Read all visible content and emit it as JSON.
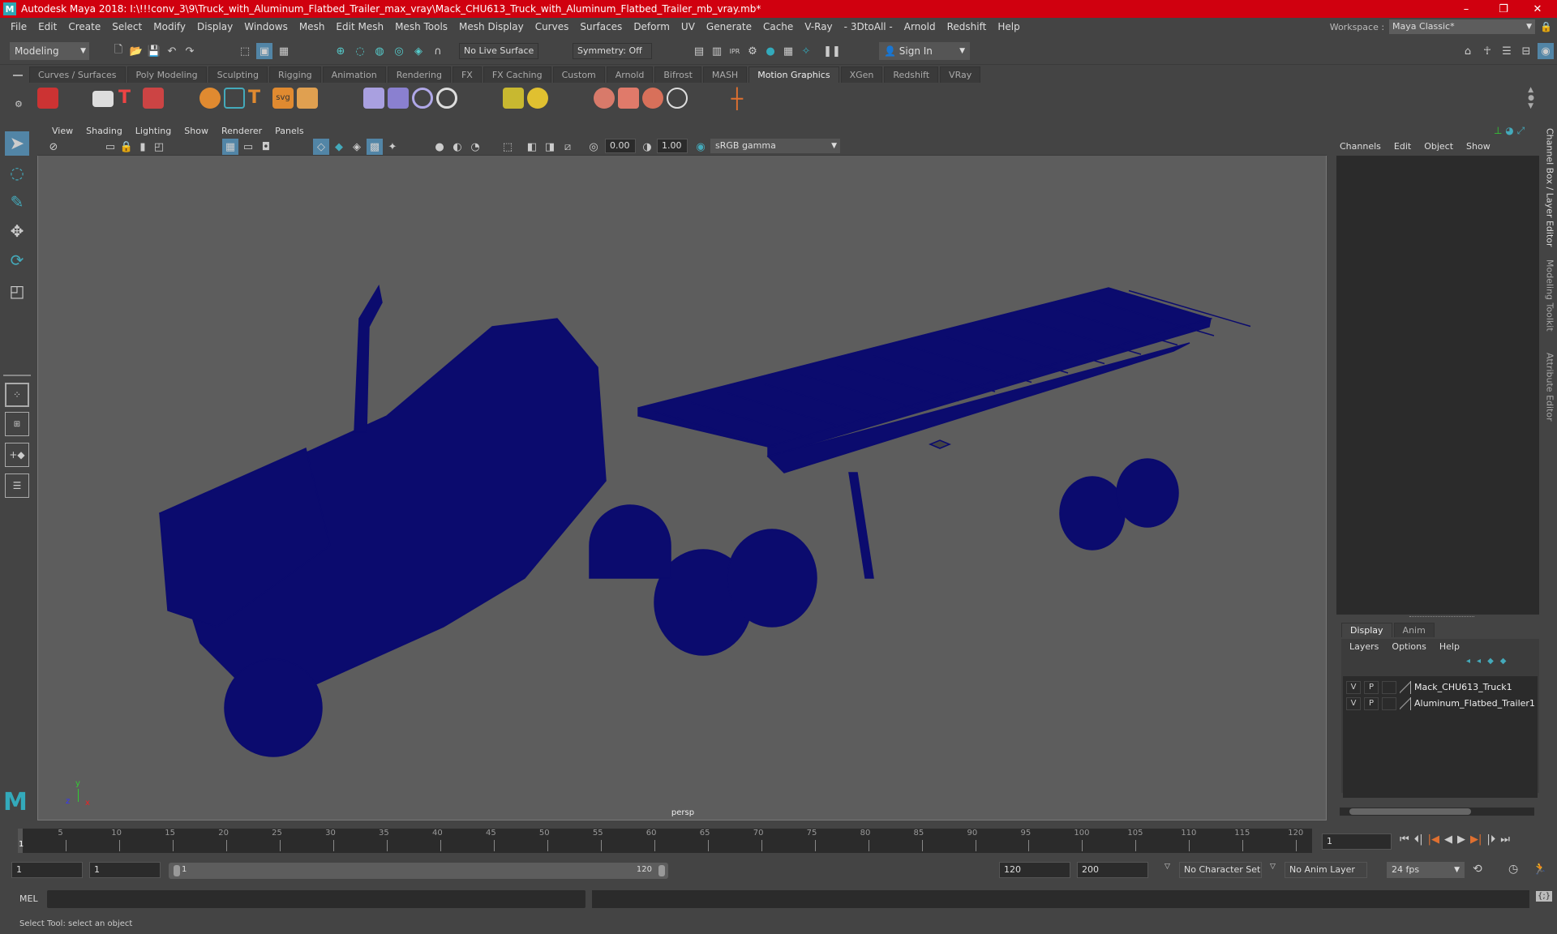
{
  "window": {
    "title": "Autodesk Maya 2018: I:\\!!!conv_3\\9\\Truck_with_Aluminum_Flatbed_Trailer_max_vray\\Mack_CHU613_Truck_with_Aluminum_Flatbed_Trailer_mb_vray.mb*",
    "logo": "M",
    "minimize": "–",
    "restore": "❐",
    "close": "✕"
  },
  "menubar": {
    "items": [
      "File",
      "Edit",
      "Create",
      "Select",
      "Modify",
      "Display",
      "Windows",
      "Mesh",
      "Edit Mesh",
      "Mesh Tools",
      "Mesh Display",
      "Curves",
      "Surfaces",
      "Deform",
      "UV",
      "Generate",
      "Cache",
      "V-Ray",
      "- 3DtoAll -",
      "Arnold",
      "Redshift",
      "Help"
    ],
    "workspace_label": "Workspace :",
    "workspace_value": "Maya Classic*"
  },
  "statusline": {
    "mode": "Modeling",
    "live_surface": "No Live Surface",
    "symmetry": "Symmetry: Off",
    "sign_in": "Sign In"
  },
  "shelf": {
    "tabs": [
      "Curves / Surfaces",
      "Poly Modeling",
      "Sculpting",
      "Rigging",
      "Animation",
      "Rendering",
      "FX",
      "FX Caching",
      "Custom",
      "Arnold",
      "Bifrost",
      "MASH",
      "Motion Graphics",
      "XGen",
      "Redshift",
      "VRay"
    ],
    "active_tab": "Motion Graphics"
  },
  "viewport": {
    "menu": [
      "View",
      "Shading",
      "Lighting",
      "Show",
      "Renderer",
      "Panels"
    ],
    "exposure": "0.00",
    "gamma": "1.00",
    "color_space": "sRGB gamma",
    "camera_label": "persp",
    "axis": {
      "x": "x",
      "y": "y",
      "z": "z"
    },
    "wireframe_color": "#0b0b6e",
    "background_color": "#5d5d5d"
  },
  "channel_box": {
    "menu": [
      "Channels",
      "Edit",
      "Object",
      "Show"
    ]
  },
  "side_tabs": [
    "Channel Box / Layer Editor",
    "Modeling Toolkit",
    "Attribute Editor"
  ],
  "layer_editor": {
    "tabs": [
      "Display",
      "Anim"
    ],
    "active_tab": "Display",
    "menu": [
      "Layers",
      "Options",
      "Help"
    ],
    "layers": [
      {
        "v": "V",
        "p": "P",
        "name": "Mack_CHU613_Truck1"
      },
      {
        "v": "V",
        "p": "P",
        "name": "Aluminum_Flatbed_Trailer1"
      }
    ]
  },
  "timeline": {
    "ticks": [
      "5",
      "10",
      "15",
      "20",
      "25",
      "30",
      "35",
      "40",
      "45",
      "50",
      "55",
      "60",
      "65",
      "70",
      "75",
      "80",
      "85",
      "90",
      "95",
      "100",
      "105",
      "110",
      "115",
      "120"
    ],
    "current_frame_marker": "1",
    "current_frame": "1"
  },
  "range": {
    "start": "1",
    "playback_start": "1",
    "slider_start": "1",
    "slider_end": "120",
    "playback_end": "120",
    "end": "200",
    "character_set": "No Character Set",
    "anim_layer": "No Anim Layer",
    "fps": "24 fps"
  },
  "command_line": {
    "label": "MEL"
  },
  "help_line": "Select Tool: select an object"
}
